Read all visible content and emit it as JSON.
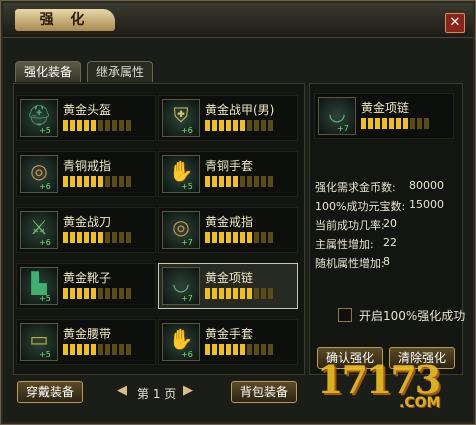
{
  "window": {
    "title": "强 化",
    "close_label": "✕"
  },
  "tabs": [
    {
      "label": "强化装备"
    },
    {
      "label": "继承属性"
    }
  ],
  "items": [
    {
      "name": "黄金头盔",
      "level": "+5",
      "filled": 5,
      "total": 10,
      "icon": "helmet-icon"
    },
    {
      "name": "黄金战甲(男)",
      "level": "+6",
      "filled": 6,
      "total": 10,
      "icon": "armor-icon"
    },
    {
      "name": "青铜戒指",
      "level": "+6",
      "filled": 6,
      "total": 10,
      "icon": "ring-icon"
    },
    {
      "name": "青铜手套",
      "level": "+5",
      "filled": 5,
      "total": 10,
      "icon": "glove-icon"
    },
    {
      "name": "黄金战刀",
      "level": "+6",
      "filled": 6,
      "total": 10,
      "icon": "sword-icon"
    },
    {
      "name": "黄金戒指",
      "level": "+7",
      "filled": 7,
      "total": 10,
      "icon": "ring-icon"
    },
    {
      "name": "黄金靴子",
      "level": "+5",
      "filled": 5,
      "total": 10,
      "icon": "boots-icon"
    },
    {
      "name": "黄金项链",
      "level": "+7",
      "filled": 7,
      "total": 10,
      "icon": "necklace-icon"
    },
    {
      "name": "黄金腰带",
      "level": "+5",
      "filled": 5,
      "total": 10,
      "icon": "belt-icon"
    },
    {
      "name": "黄金手套",
      "level": "+6",
      "filled": 6,
      "total": 10,
      "icon": "glove-icon"
    }
  ],
  "selected": {
    "name": "黄金项链",
    "level": "+7",
    "filled": 7,
    "total": 10,
    "icon": "necklace-icon"
  },
  "stats": [
    {
      "label": "强化需求金币数:",
      "value": "80000"
    },
    {
      "label": "100%成功元宝数:",
      "value": "15000"
    },
    {
      "label": "当前成功几率:",
      "value": "20"
    },
    {
      "label": "主属性增加:",
      "value": "22"
    },
    {
      "label": "随机属性增加:",
      "value": "8"
    }
  ],
  "option": {
    "label": "开启100%强化成功"
  },
  "buttons": {
    "equip": "穿戴装备",
    "bag": "背包装备",
    "enhance": "确认强化",
    "clear": "清除强化"
  },
  "pager": {
    "prev": "◀",
    "next": "▶",
    "text": "第 1 页"
  },
  "watermark": {
    "logo": "17173",
    "domain": ".COM"
  }
}
